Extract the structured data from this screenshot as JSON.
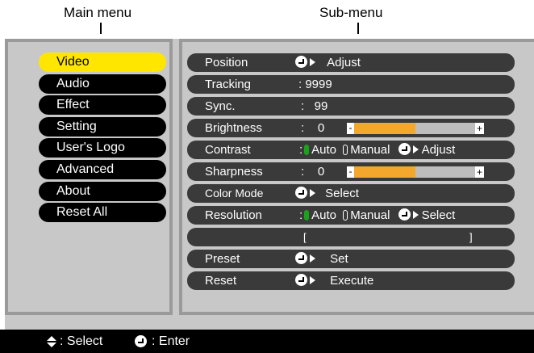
{
  "callouts": {
    "main_menu": "Main menu",
    "sub_menu": "Sub-menu"
  },
  "main_menu": [
    {
      "label": "Video",
      "active": true
    },
    {
      "label": "Audio",
      "active": false
    },
    {
      "label": "Effect",
      "active": false
    },
    {
      "label": "Setting",
      "active": false
    },
    {
      "label": "User's Logo",
      "active": false
    },
    {
      "label": "Advanced",
      "active": false
    },
    {
      "label": "About",
      "active": false
    },
    {
      "label": "Reset All",
      "active": false
    }
  ],
  "sub_menu": {
    "position": {
      "label": "Position",
      "action": "Adjust"
    },
    "tracking": {
      "label": "Tracking",
      "value": ": 9999"
    },
    "sync": {
      "label": "Sync.",
      "value": ":   99"
    },
    "brightness": {
      "label": "Brightness",
      "value": ":    0",
      "level": 0.5
    },
    "contrast": {
      "label": "Contrast",
      "colon": ":",
      "opt_auto": "Auto",
      "opt_manual": "Manual",
      "action": "Adjust"
    },
    "sharpness": {
      "label": "Sharpness",
      "value": ":    0",
      "level": 0.5
    },
    "color_mode": {
      "label": "Color Mode",
      "action": "Select"
    },
    "resolution": {
      "label": "Resolution",
      "colon": ":",
      "opt_auto": "Auto",
      "opt_manual": "Manual",
      "action": "Select"
    },
    "resolution_bracket": {
      "open": "[",
      "close": "]"
    },
    "preset": {
      "label": "Preset",
      "action": "Set"
    },
    "reset": {
      "label": "Reset",
      "action": "Execute"
    }
  },
  "footer": {
    "select_label": ": Select",
    "enter_label": ": Enter"
  },
  "colors": {
    "active_menu": "#ffe600",
    "bar_fill": "#f3a72d",
    "radio_on": "#1aa31a"
  }
}
